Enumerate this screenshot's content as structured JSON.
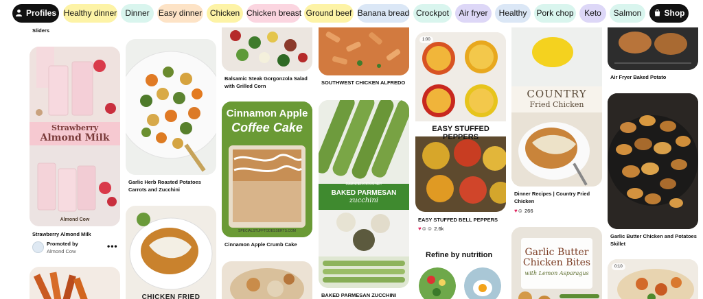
{
  "chips": [
    {
      "label": "Profiles",
      "bg": "#111111",
      "dark": true
    },
    {
      "label": "Healthy dinner",
      "bg": "#fdf3a6"
    },
    {
      "label": "Dinner",
      "bg": "#d9f5ee"
    },
    {
      "label": "Easy dinner",
      "bg": "#fde3c6"
    },
    {
      "label": "Chicken",
      "bg": "#fdf3a6"
    },
    {
      "label": "Chicken breast",
      "bg": "#fbd5e0"
    },
    {
      "label": "Ground beef",
      "bg": "#fdf3a6"
    },
    {
      "label": "Banana bread",
      "bg": "#dbe7f6"
    },
    {
      "label": "Crockpot",
      "bg": "#d9f5ee"
    },
    {
      "label": "Air fryer",
      "bg": "#ddd7f7"
    },
    {
      "label": "Healthy",
      "bg": "#dbe7f6"
    },
    {
      "label": "Pork chop",
      "bg": "#d9f5ee"
    },
    {
      "label": "Keto",
      "bg": "#ddd7f7"
    },
    {
      "label": "Salmon",
      "bg": "#d9f5ee"
    },
    {
      "label": "Shop",
      "bg": "#111111",
      "dark": true
    }
  ],
  "pins": {
    "sliders": {
      "caption": "Sliders"
    },
    "strawberry_milk": {
      "overlay_line1": "Strawberry",
      "overlay_line2": "Almond Milk",
      "watermark": "Almond Cow",
      "caption": "Strawberry Almond Milk",
      "promoted_label": "Promoted by",
      "promoter": "Almond Cow",
      "more": "•••"
    },
    "roasted_potatoes": {
      "caption": "Garlic Herb Roasted Potatoes Carrots and Zucchini"
    },
    "chicken_fried": {
      "overlay": "CHICKEN FRIED CHICKEN"
    },
    "balsamic_salad": {
      "caption": "Balsamic Steak Gorgonzola Salad with Grilled Corn"
    },
    "coffee_cake": {
      "overlay_line1": "Cinnamon Apple",
      "overlay_line2": "Coffee Cake",
      "watermark": "SPECIALSTUFFTODESSERTS.COM",
      "caption": "Cinnamon Apple Crumb Cake"
    },
    "chicken_alfredo": {
      "caption": "SOUTHWEST CHICKEN ALFREDO"
    },
    "parmesan_zucchini": {
      "site": "DAMNDELICIOUS.NET",
      "overlay_line1": "BAKED PARMESAN",
      "overlay_line2": "zucchini",
      "caption": "BAKED PARMESAN ZUCCHINI"
    },
    "stuffed_peppers": {
      "duration": "1:00",
      "overlay": "EASY STUFFED PEPPERS",
      "caption": "EASY STUFFED BELL PEPPERS",
      "reactions": "2.6k"
    },
    "refine": {
      "title": "Refine by nutrition"
    },
    "country_chicken": {
      "overlay_line1": "COUNTRY",
      "overlay_line2": "Fried Chicken",
      "caption": "Dinner Recipes | Country Fried Chicken",
      "reactions": "266"
    },
    "garlic_bites": {
      "overlay_line1": "Garlic Butter",
      "overlay_line2": "Chicken Bites",
      "overlay_line3": "with Lemon Asparagus"
    },
    "air_fryer_potato": {
      "caption": "Air Fryer Baked Potato"
    },
    "garlic_skillet": {
      "caption": "Garlic Butter Chicken and Potatoes Skillet"
    },
    "bottom_right": {
      "duration": "0:10"
    }
  }
}
